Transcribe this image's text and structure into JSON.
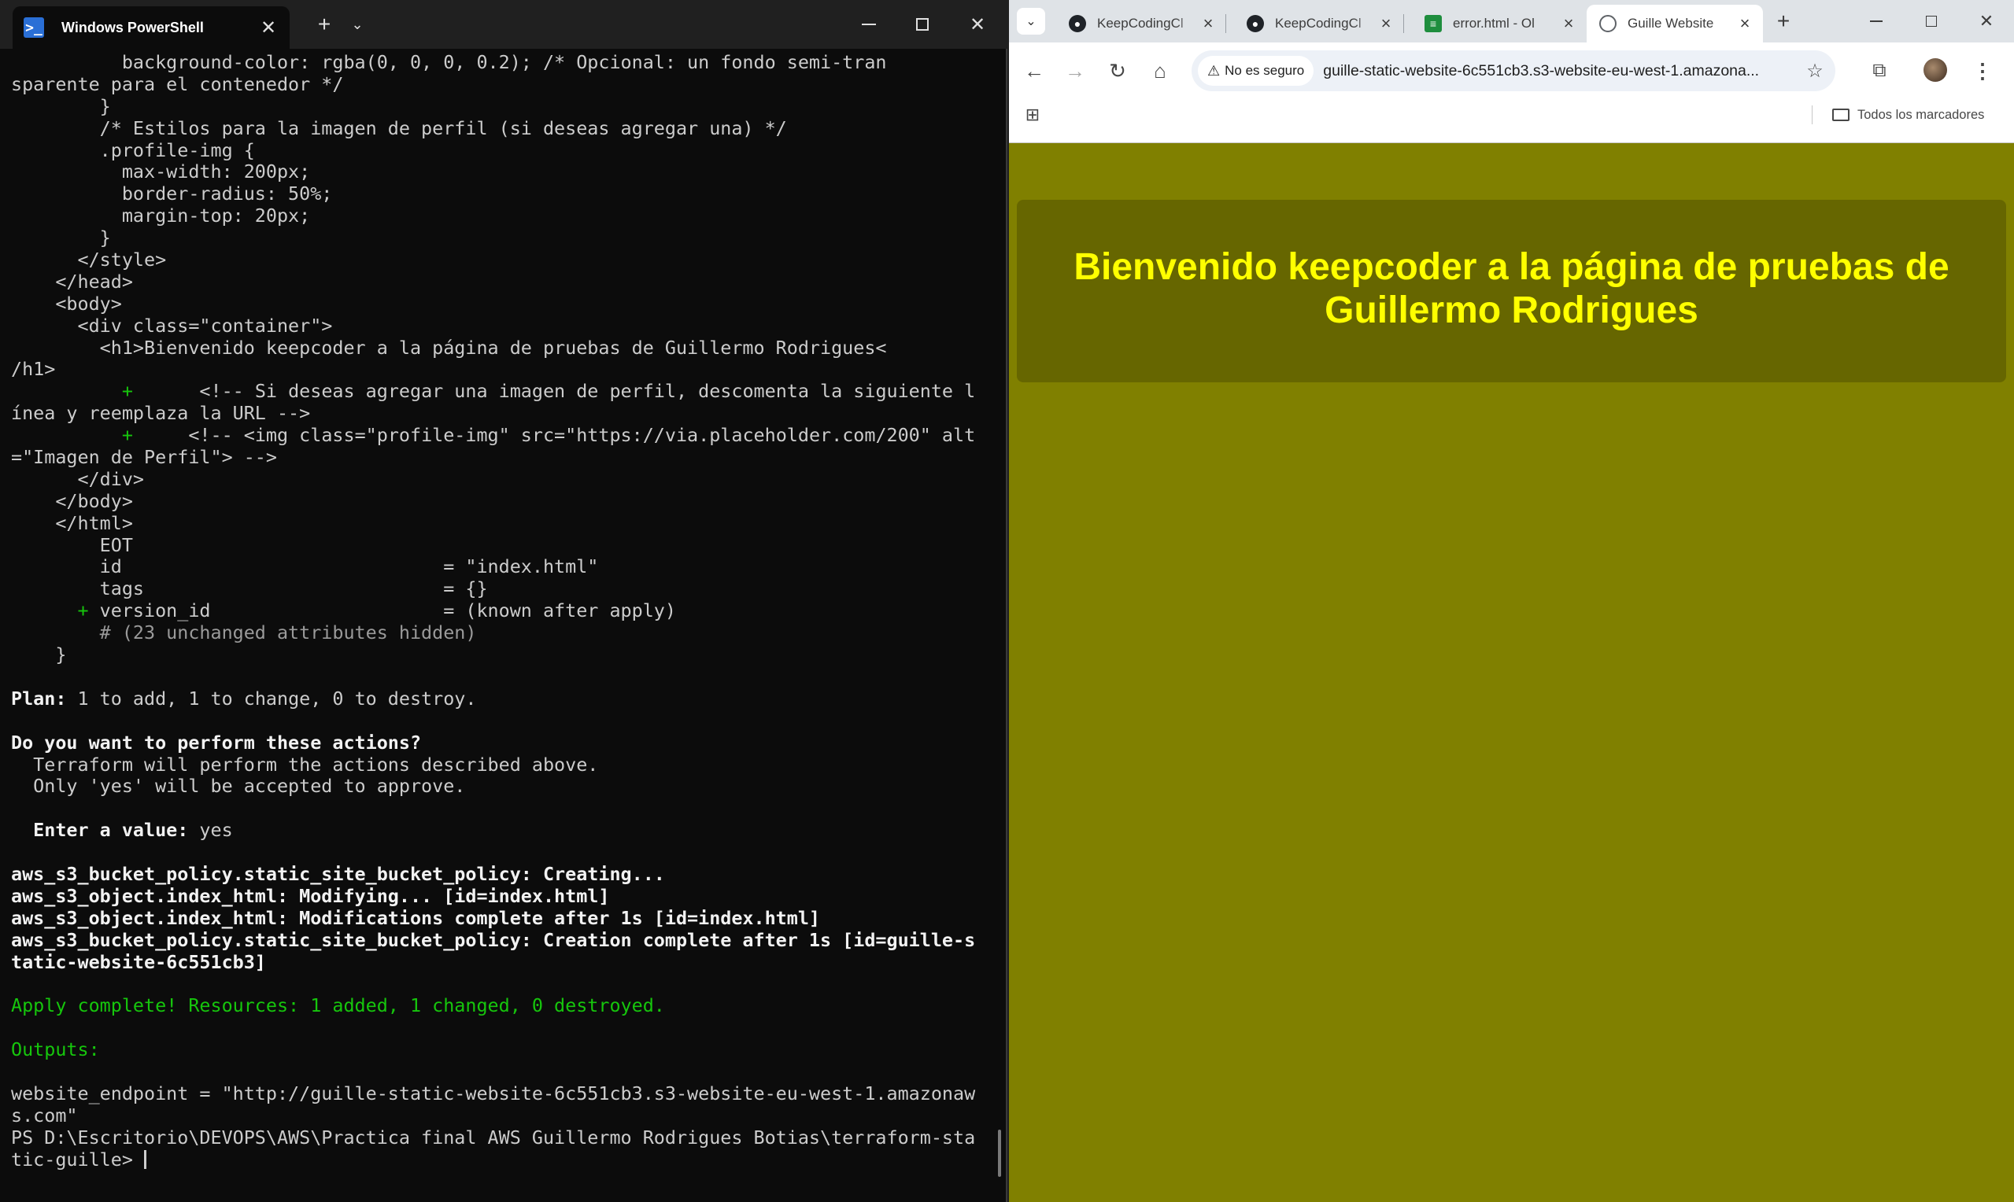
{
  "powershell": {
    "tab_title": "Windows PowerShell",
    "tab_icon": "powershell-icon",
    "lines": [
      {
        "text": "          background-color: rgba(0, 0, 0, 0.2); /* Opcional: un fondo semi-tran",
        "style": "normal"
      },
      {
        "text": "sparente para el contenedor */",
        "style": "normal"
      },
      {
        "text": "        }",
        "style": "normal"
      },
      {
        "text": "        /* Estilos para la imagen de perfil (si deseas agregar una) */",
        "style": "normal"
      },
      {
        "text": "        .profile-img {",
        "style": "normal"
      },
      {
        "text": "          max-width: 200px;",
        "style": "normal"
      },
      {
        "text": "          border-radius: 50%;",
        "style": "normal"
      },
      {
        "text": "          margin-top: 20px;",
        "style": "normal"
      },
      {
        "text": "        }",
        "style": "normal"
      },
      {
        "text": "      </style>",
        "style": "normal"
      },
      {
        "text": "    </head>",
        "style": "normal"
      },
      {
        "text": "    <body>",
        "style": "normal"
      },
      {
        "text": "      <div class=\"container\">",
        "style": "normal"
      },
      {
        "text": "        <h1>Bienvenido keepcoder a la página de pruebas de Guillermo Rodrigues<",
        "style": "normal"
      },
      {
        "text": "/h1>",
        "style": "normal"
      },
      {
        "text": "+      <!-- Si deseas agregar una imagen de perfil, descomenta la siguiente l",
        "style": "plus",
        "indent": "          "
      },
      {
        "text": "ínea y reemplaza la URL -->",
        "style": "normal"
      },
      {
        "text": "+     <!-- <img class=\"profile-img\" src=\"https://via.placeholder.com/200\" alt",
        "style": "plus",
        "indent": "          "
      },
      {
        "text": "=\"Imagen de Perfil\"> -->",
        "style": "normal"
      },
      {
        "text": "      </div>",
        "style": "normal"
      },
      {
        "text": "    </body>",
        "style": "normal"
      },
      {
        "text": "    </html>",
        "style": "normal"
      },
      {
        "text": "        EOT",
        "style": "normal"
      },
      {
        "text": "        id                             = \"index.html\"",
        "style": "normal"
      },
      {
        "text": "        tags                           = {}",
        "style": "normal"
      },
      {
        "text": "+ version_id                     = (known after apply)",
        "style": "plus",
        "indent": "      "
      },
      {
        "text": "        # (23 unchanged attributes hidden)",
        "style": "gray"
      },
      {
        "text": "    }",
        "style": "normal"
      },
      {
        "text": "",
        "style": "normal"
      },
      {
        "text": "Plan: 1 to add, 1 to change, 0 to destroy.",
        "style": "plan"
      },
      {
        "text": "",
        "style": "normal"
      },
      {
        "text": "Do you want to perform these actions?",
        "style": "bold"
      },
      {
        "text": "  Terraform will perform the actions described above.",
        "style": "normal"
      },
      {
        "text": "  Only 'yes' will be accepted to approve.",
        "style": "normal"
      },
      {
        "text": "",
        "style": "normal"
      },
      {
        "text": "  Enter a value: yes",
        "style": "bold-label"
      },
      {
        "text": "",
        "style": "normal"
      },
      {
        "text": "aws_s3_bucket_policy.static_site_bucket_policy: Creating...",
        "style": "bold"
      },
      {
        "text": "aws_s3_object.index_html: Modifying... [id=index.html]",
        "style": "bold"
      },
      {
        "text": "aws_s3_object.index_html: Modifications complete after 1s [id=index.html]",
        "style": "bold"
      },
      {
        "text": "aws_s3_bucket_policy.static_site_bucket_policy: Creation complete after 1s [id=guille-s",
        "style": "bold"
      },
      {
        "text": "tatic-website-6c551cb3]",
        "style": "bold"
      },
      {
        "text": "",
        "style": "normal"
      },
      {
        "text": "Apply complete! Resources: 1 added, 1 changed, 0 destroyed.",
        "style": "green"
      },
      {
        "text": "",
        "style": "normal"
      },
      {
        "text": "Outputs:",
        "style": "green"
      },
      {
        "text": "",
        "style": "normal"
      },
      {
        "text": "website_endpoint = \"http://guille-static-website-6c551cb3.s3-website-eu-west-1.amazonaw",
        "style": "normal"
      },
      {
        "text": "s.com\"",
        "style": "normal"
      },
      {
        "text": "PS D:\\Escritorio\\DEVOPS\\AWS\\Practica final AWS Guillermo Rodrigues Botias\\terraform-sta",
        "style": "normal"
      },
      {
        "text": "tic-guille> ",
        "style": "prompt"
      }
    ]
  },
  "chrome": {
    "tabs": [
      {
        "title": "KeepCodingCl",
        "icon": "github-icon",
        "active": false
      },
      {
        "title": "KeepCodingCl",
        "icon": "github-icon",
        "active": false
      },
      {
        "title": "error.html - Ol",
        "icon": "document-icon",
        "active": false
      },
      {
        "title": "Guille Website",
        "icon": "globe-icon",
        "active": true
      }
    ],
    "security_label": "No es seguro",
    "url": "guille-static-website-6c551cb3.s3-website-eu-west-1.amazona...",
    "bookmarks_label": "Todos los marcadores",
    "accent_color": "#808000"
  },
  "page": {
    "heading": "Bienvenido keepcoder a la página de pruebas de Guillermo Rodrigues",
    "background_color": "#808000",
    "heading_color": "#ffff00"
  }
}
